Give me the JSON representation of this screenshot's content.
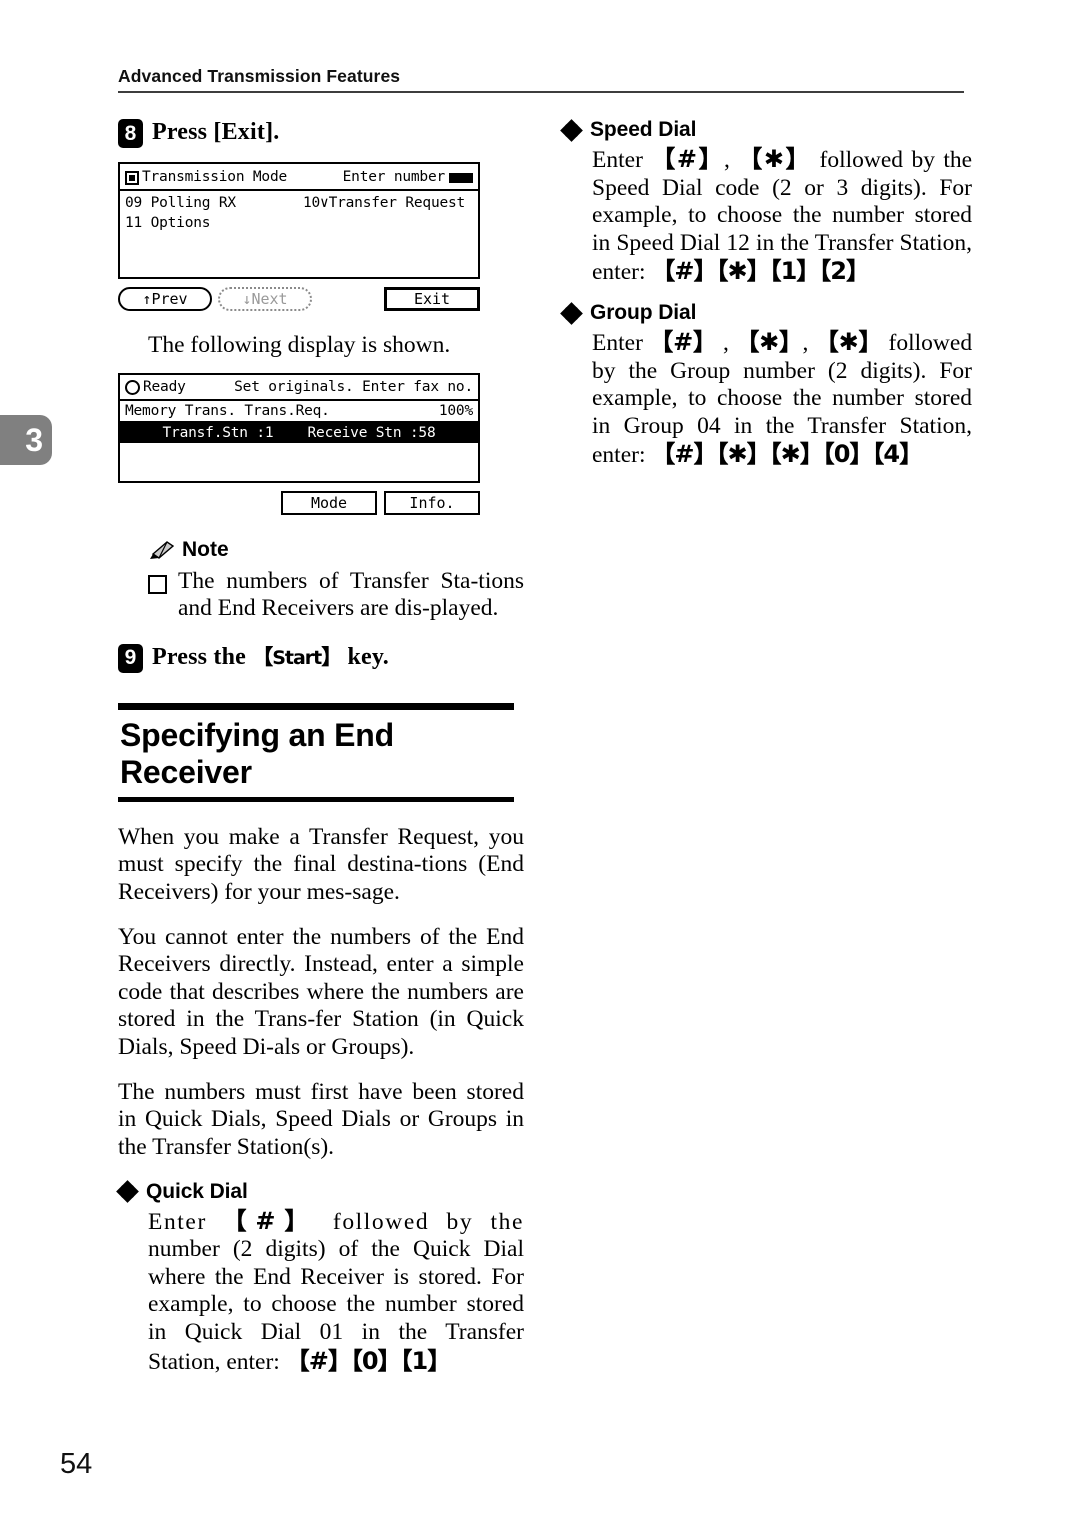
{
  "header": {
    "running_title": "Advanced Transmission Features"
  },
  "chapter_tab": {
    "number": "3"
  },
  "page_number": "54",
  "left_column": {
    "step8": {
      "number": "8",
      "text_before": "Press [Exit]."
    },
    "lcd1": {
      "status_icon": "filled-square-icon",
      "title": "Transmission Mode",
      "prompt": "Enter number",
      "cursor": "input-cursor-block",
      "lines": [
        {
          "left": "09 Polling RX",
          "right": "10∨Transfer Request"
        },
        {
          "left": "11 Options",
          "right": ""
        }
      ],
      "softkeys": {
        "prev": "↑Prev",
        "next": "↓Next",
        "exit": "Exit"
      }
    },
    "caption": "The following display is shown.",
    "lcd2": {
      "status_icon": "circle-icon",
      "status": "Ready",
      "prompt": "Set originals. Enter fax no.",
      "mode_line": "Memory Trans. Trans.Req.",
      "percent": "100%",
      "highlight": "Transf.Stn :1    Receive Stn :58",
      "softkeys": {
        "mode": "Mode",
        "info": "Info."
      }
    },
    "note": {
      "icon": "pencil-icon",
      "label": "Note",
      "items": [
        "The numbers of Transfer Sta-tions and End Receivers are dis-played."
      ]
    },
    "step9": {
      "number": "9",
      "text_before": "Press the ",
      "key_label": "Start",
      "text_after": " key."
    },
    "section": {
      "title": "Specifying an End Receiver",
      "paragraphs": [
        "When you make a Transfer Request, you must specify the final destina-tions (End Receivers) for your mes-sage.",
        "You cannot enter the numbers of the End Receivers directly. Instead, enter a simple code that describes where the numbers are stored in the Trans-fer Station (in Quick Dials, Speed Di-als or Groups).",
        "The numbers must first have been stored in Quick Dials, Speed Dials or Groups in the Transfer Station(s)."
      ]
    },
    "quick_dial": {
      "bullet": "diamond-bullet-icon",
      "label": "Quick Dial",
      "line1_pre": "Enter",
      "key1": "#",
      "line1_post": "followed by the",
      "line2": "number (2 digits) of the Quick Dial where the End Receiver is stored. For example, to choose the number stored in Quick Dial 01 in the Transfer Station, enter:",
      "keys_example": [
        "#",
        "0",
        "1"
      ]
    }
  },
  "right_column": {
    "speed_dial": {
      "bullet": "diamond-bullet-icon",
      "label": "Speed Dial",
      "line1_pre": "Enter",
      "key1": "#",
      "key2": "✱",
      "line1_post": "followed by the",
      "line2": "Speed Dial code (2 or 3 digits). For example, to choose the number stored in Speed Dial 12 in the Transfer Station, enter:",
      "keys_example": [
        "#",
        "✱",
        "1",
        "2"
      ]
    },
    "group_dial": {
      "bullet": "diamond-bullet-icon",
      "label": "Group Dial",
      "line1_pre": "Enter",
      "key1": "#",
      "key2": "✱",
      "key3": "✱",
      "line1_post": "followed",
      "line2": "by the Group number (2 digits). For example, to choose the number stored in Group 04 in the Transfer Station, enter:",
      "keys_example": [
        "#",
        "✱",
        "✱",
        "0",
        "4"
      ]
    }
  },
  "colors": {
    "tab_gray": "#808080",
    "rule_black": "#000000",
    "next_key_gray": "#9a9a9a"
  }
}
